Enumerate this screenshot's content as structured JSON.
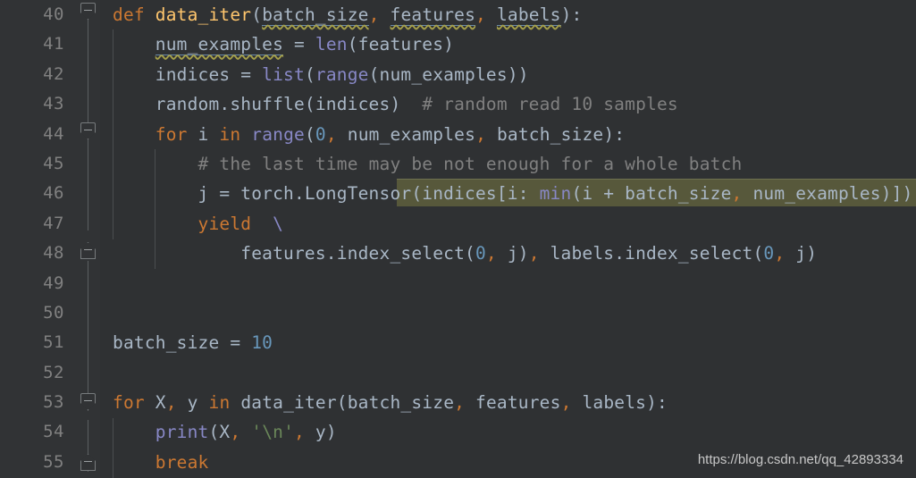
{
  "editor": {
    "theme": "darcula",
    "colors": {
      "background": "#2f3133",
      "gutter_background": "#313335",
      "line_number": "#808080",
      "default_text": "#a9b7c6",
      "keyword": "#cc7832",
      "function_name": "#ffc66d",
      "builtin": "#8888c6",
      "number": "#6897bb",
      "string": "#6a8759",
      "comment": "#808080",
      "selection_highlight": "#57583b",
      "indent_guide": "#4b4e50",
      "fold_marker": "#777b7d"
    },
    "first_line_number": 40,
    "last_line_number": 55
  },
  "line_numbers": [
    "40",
    "41",
    "42",
    "43",
    "44",
    "45",
    "46",
    "47",
    "48",
    "49",
    "50",
    "51",
    "52",
    "53",
    "54",
    "55"
  ],
  "fold_markers": [
    {
      "line": 40,
      "direction": "down",
      "state": "expanded"
    },
    {
      "line": 44,
      "direction": "down",
      "state": "expanded"
    },
    {
      "line": 48,
      "direction": "up",
      "state": "expanded"
    },
    {
      "line": 53,
      "direction": "down",
      "state": "expanded"
    },
    {
      "line": 55,
      "direction": "up",
      "state": "expanded"
    }
  ],
  "selection": {
    "line": 46,
    "text": "(indices[i: min(i + batch_size, num_examples)])"
  },
  "lines": [
    {
      "n": "40",
      "text": "def data_iter(batch_size, features, labels):"
    },
    {
      "n": "41",
      "text": "    num_examples = len(features)"
    },
    {
      "n": "42",
      "text": "    indices = list(range(num_examples))"
    },
    {
      "n": "43",
      "text": "    random.shuffle(indices)  # random read 10 samples"
    },
    {
      "n": "44",
      "text": "    for i in range(0, num_examples, batch_size):"
    },
    {
      "n": "45",
      "text": "        # the last time may be not enough for a whole batch"
    },
    {
      "n": "46",
      "text": "        j = torch.LongTensor(indices[i: min(i + batch_size, num_examples)])"
    },
    {
      "n": "47",
      "text": "        yield  \\"
    },
    {
      "n": "48",
      "text": "            features.index_select(0, j), labels.index_select(0, j)"
    },
    {
      "n": "49",
      "text": ""
    },
    {
      "n": "50",
      "text": ""
    },
    {
      "n": "51",
      "text": "batch_size = 10"
    },
    {
      "n": "52",
      "text": ""
    },
    {
      "n": "53",
      "text": "for X, y in data_iter(batch_size, features, labels):"
    },
    {
      "n": "54",
      "text": "    print(X, '\\n', y)"
    },
    {
      "n": "55",
      "text": "    break"
    }
  ],
  "watermark": {
    "text": "https://blog.csdn.net/qq_42893334"
  }
}
